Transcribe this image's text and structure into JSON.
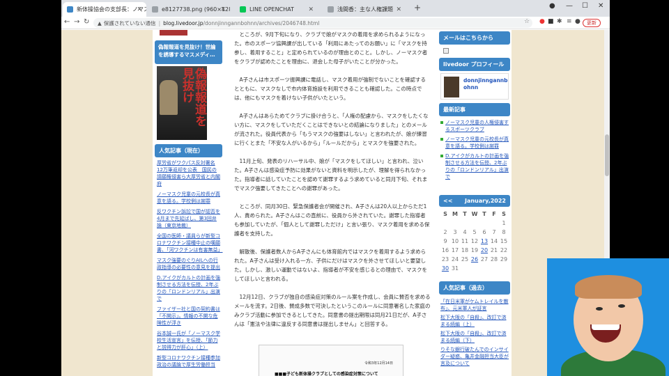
{
  "tabs": [
    {
      "title": "新体操協会の支部長：ノマスク児童",
      "color": "#3d86c6"
    },
    {
      "title": "e8127738.png (960×1280)",
      "color": "#9aa0a6"
    },
    {
      "title": "LINE OPENCHAT",
      "color": "#06c755"
    },
    {
      "title": "浅間香：主な人権課題",
      "color": "#9aa0a6"
    }
  ],
  "address": {
    "warning": "保護されていない通信",
    "host": "blog.livedoor.jp",
    "path": "/donnjinngannbohnn/archives/2046748.html"
  },
  "update_label": "更新",
  "left": {
    "book_link": "偽報報道を見抜け！世論を誘導するマスメディ…",
    "book_cover": "偽報報道を見抜け",
    "popular_header": "人気記事（現在）",
    "links": [
      "厚労省がワクパス反対署名12万筆返却を公表　国民の請願権侵害ら大厚労省と内閣府",
      "ノーマスク児童の元校長が真意を語る。学校側は謝罪",
      "反ワクチン訴訟で国が認否を4月まで先延ばし、第3回弁論（東京地裁）",
      "全国の医師・議員らが新型コロナワクチン接種中止の嘆願書、「河ワクチンは有害無益」",
      "マスク強要のぐりAILへの行政指導の必要性の意見を提出",
      "D.アイクがカルトの計画を強制させる方法を伝授、2年ぶりの「ロンドンリアル」出演で",
      "ファイザー社と国の契約書は「不開示」。情報の不開な危険性が浮き",
      "谷本誠一氏が「ノーマスク学校生活宣言」を伝授、「節力と説得力が肝心」（上）",
      "新型コロナワクチン接種参加政治の議論で厚生労働担当"
    ]
  },
  "article": [
    "ところが、9月下旬になり、クラブで娘がマスクの着用を求められるようになった。市のスポーツ協興課が出している「利用にあたってのお願い」に「マスクを持参し、着用すること」と定められているのが理由とのこと。しかし、ノーマスク者をクラブが認めたことを理由に、退会した母子がいたことが分かった。",
    "A子さんは市スポーツ振興課に電話し、マスク着用が強制でないことを確認するとともに、マスクなしで市内体育施設を利用できることも確認した。この時点では、他にもマスクを着けない子供がいたという。",
    "A子さんはあらためてクラブに掛け合うと、「人権の配慮から、マスクをしたくない方に、マスクをしていただくことはできないとの結論になりました」とのメールが流された。役員代表から「もうマスクの強要はしない」と言われたが、娘が練習に行くとまた「不安な人がいるから」「ルールだから」とマスクを強要された。",
    "11月上旬、発表のリハーサル中、娘が「マスクをしてほしい」と言われ、泣いた。A子さんは感染症予防に効果がないと資料を明示したが、理解を得られなかった。指導者に話していたことを認めて謝罪するよう求めていると同月下旬、それまでマスク強要してきたことへの謝罪があった。",
    "ところが、同月30日、緊急保護者会が開催され、A子さんは20人以上からただ1人、責められた。A子さんはこの直前に、役員から外されていた。謝罪した指導者も参加していたが、「個人として謝罪しただけ」と言い張り、マスク着用を求める保護者を支持した。",
    "解散後、保護者数人からA子さんにも体育館内ではマスクを着用するよう求められた。A子さんは受け入れる一方、子供にだけはマスクを外させてほしいと要望した。しかし、激しい運動ではないよ、指導者が不安を感じるとの理由で、マスクをしてほしいと言われる。",
    "12月12日、クラブが独自の感染症対策のルール案を作成し、会員に賛否を求めるメールを流す。2日後、賛成多数で可決したというこのルールに同意署名した家庭のみクラブ活動に参加できるとしてきた。同意書の提出期限は同月21日だが、A子さんは「憲法や法律に違反する同意書は提出しません」と回答する。"
  ],
  "doc": {
    "date": "令和3年12月14日",
    "title": "■■■子ども新体操クラブとしての感染症対策について"
  },
  "right": {
    "mail_header": "メールはこちらから",
    "profile_header": "livedoor プロフィール",
    "profile_name": "donnjinngannbohnn",
    "recent_header": "最新記事",
    "recent": [
      "ノーマスク児童の人権侵害するスポーツクラブ",
      "ノーマスク児童の元校長が真意を語る。学校側は謝罪",
      "D.アイクがカルトの計画を強制させる方法を伝授、2年ぶりの「ロンドンリアル」出演で"
    ],
    "cal_prev": "<<",
    "cal_month": "January,2022",
    "cal_days": [
      "S",
      "M",
      "T",
      "W",
      "T",
      "F",
      "S"
    ],
    "cal_rows": [
      [
        "",
        "",
        "",
        "",
        "",
        "",
        "1"
      ],
      [
        "2",
        "3",
        "4",
        "5",
        "6",
        "7",
        "8"
      ],
      [
        "9",
        "10",
        "11",
        "12",
        "13",
        "14",
        "15"
      ],
      [
        "16",
        "17",
        "18",
        "19",
        "20",
        "21",
        "22"
      ],
      [
        "23",
        "24",
        "25",
        "26",
        "27",
        "28",
        "29"
      ],
      [
        "30",
        "31",
        "",
        "",
        "",
        "",
        ""
      ]
    ],
    "cal_links": [
      "13",
      "20",
      "26",
      "30"
    ],
    "past_header": "人気記事（過去）",
    "past": [
      "「在日米軍がケムトレイルを散布」、元米軍人が証言",
      "松下大阪の「自殺」、改訂で済まる続編（上）",
      "松下大阪の「自殺」、改訂で済まる続編（下）",
      "りそな銀行破たんでのインサイダー疑惑、亀井金融担当大臣が言及について"
    ]
  }
}
